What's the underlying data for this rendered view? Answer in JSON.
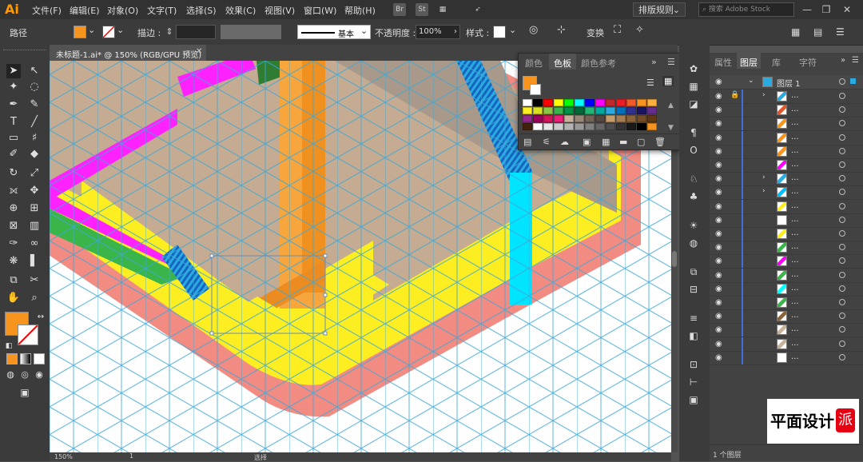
{
  "app": {
    "logo": "Ai"
  },
  "menus": [
    "文件(F)",
    "编辑(E)",
    "对象(O)",
    "文字(T)",
    "选择(S)",
    "效果(C)",
    "视图(V)",
    "窗口(W)",
    "帮助(H)"
  ],
  "menubar_icons": {
    "br": "Br",
    "st": "St"
  },
  "workspace": {
    "label": "排版规则",
    "chevron": "⌄"
  },
  "search": {
    "placeholder": "搜索 Adobe Stock"
  },
  "window_controls": {
    "minimize": "—",
    "restore": "❐",
    "close": "✕"
  },
  "control_bar": {
    "object_type": "路径",
    "stroke_label": "描边 :",
    "stroke_style": "基本",
    "opacity_label": "不透明度 :",
    "opacity_value": "100%",
    "style_label": "样式 :",
    "transform_label": "变换",
    "fill_color": "#f7941d"
  },
  "document": {
    "tab_title": "未标题-1.ai* @ 150% (RGB/GPU 预览)",
    "close": "✕"
  },
  "status": {
    "zoom": "150%",
    "artboard": "1",
    "tool": "选择"
  },
  "color_panel": {
    "tabs": [
      "颜色",
      "色板",
      "颜色参考"
    ],
    "active_tab": "色板",
    "fill_color": "#f7941d",
    "swatch_rows": [
      [
        "#ffffff",
        "#000000",
        "#ff0000",
        "#ffff00",
        "#00ff00",
        "#00ffff",
        "#0000ff",
        "#ff00ff",
        "#c1272d",
        "#ed1c24",
        "#f15a24",
        "#f7931e",
        "#fbb03b"
      ],
      [
        "#fcee21",
        "#d9e021",
        "#8cc63f",
        "#39b54a",
        "#009245",
        "#006837",
        "#22b573",
        "#00a99d",
        "#29abe2",
        "#0071bc",
        "#2e3192",
        "#1b1464",
        "#662d91"
      ],
      [
        "#93278f",
        "#9e005d",
        "#d4145a",
        "#ed1e79",
        "#c7b299",
        "#998675",
        "#736357",
        "#534741",
        "#c69c6d",
        "#a67c52",
        "#8c6239",
        "#754c24",
        "#603813"
      ],
      [
        "#42210b",
        "#ffffff",
        "#e6e6e6",
        "#cccccc",
        "#b3b3b3",
        "#999999",
        "#808080",
        "#666666",
        "#4d4d4d",
        "#333333",
        "#1a1a1a",
        "#000000",
        "#f7941d"
      ]
    ]
  },
  "right_panel": {
    "tabs": [
      "属性",
      "图层",
      "库",
      "字符"
    ],
    "active_tab": "图层",
    "layer_name": "图层 1",
    "sublayers": [
      {
        "name": "...",
        "thumb": "#29abe2"
      },
      {
        "name": "...",
        "thumb": "#e2552b"
      },
      {
        "name": "...",
        "thumb": "#f7941d"
      },
      {
        "name": "...",
        "thumb": "#f7941d"
      },
      {
        "name": "...",
        "thumb": "#f7941d"
      },
      {
        "name": "...",
        "thumb": "#ff00ff"
      },
      {
        "name": "...",
        "thumb": "#29abe2"
      },
      {
        "name": "...",
        "thumb": "#00bfff"
      },
      {
        "name": "...",
        "thumb": "#fcee21"
      },
      {
        "name": "...",
        "thumb": "#ffffff"
      },
      {
        "name": "...",
        "thumb": "#fcee21"
      },
      {
        "name": "...",
        "thumb": "#39b54a"
      },
      {
        "name": "...",
        "thumb": "#ff00ff"
      },
      {
        "name": "...",
        "thumb": "#39b54a"
      },
      {
        "name": "...",
        "thumb": "#00ffff"
      },
      {
        "name": "...",
        "thumb": "#39b54a"
      },
      {
        "name": "...",
        "thumb": "#8c6239"
      },
      {
        "name": "...",
        "thumb": "#c7b299"
      },
      {
        "name": "...",
        "thumb": "#c7b299"
      },
      {
        "name": "...",
        "thumb": "#ffffff"
      }
    ],
    "footer": "1 个图层"
  },
  "watermark": {
    "text": "平面设计",
    "badge": "派"
  }
}
